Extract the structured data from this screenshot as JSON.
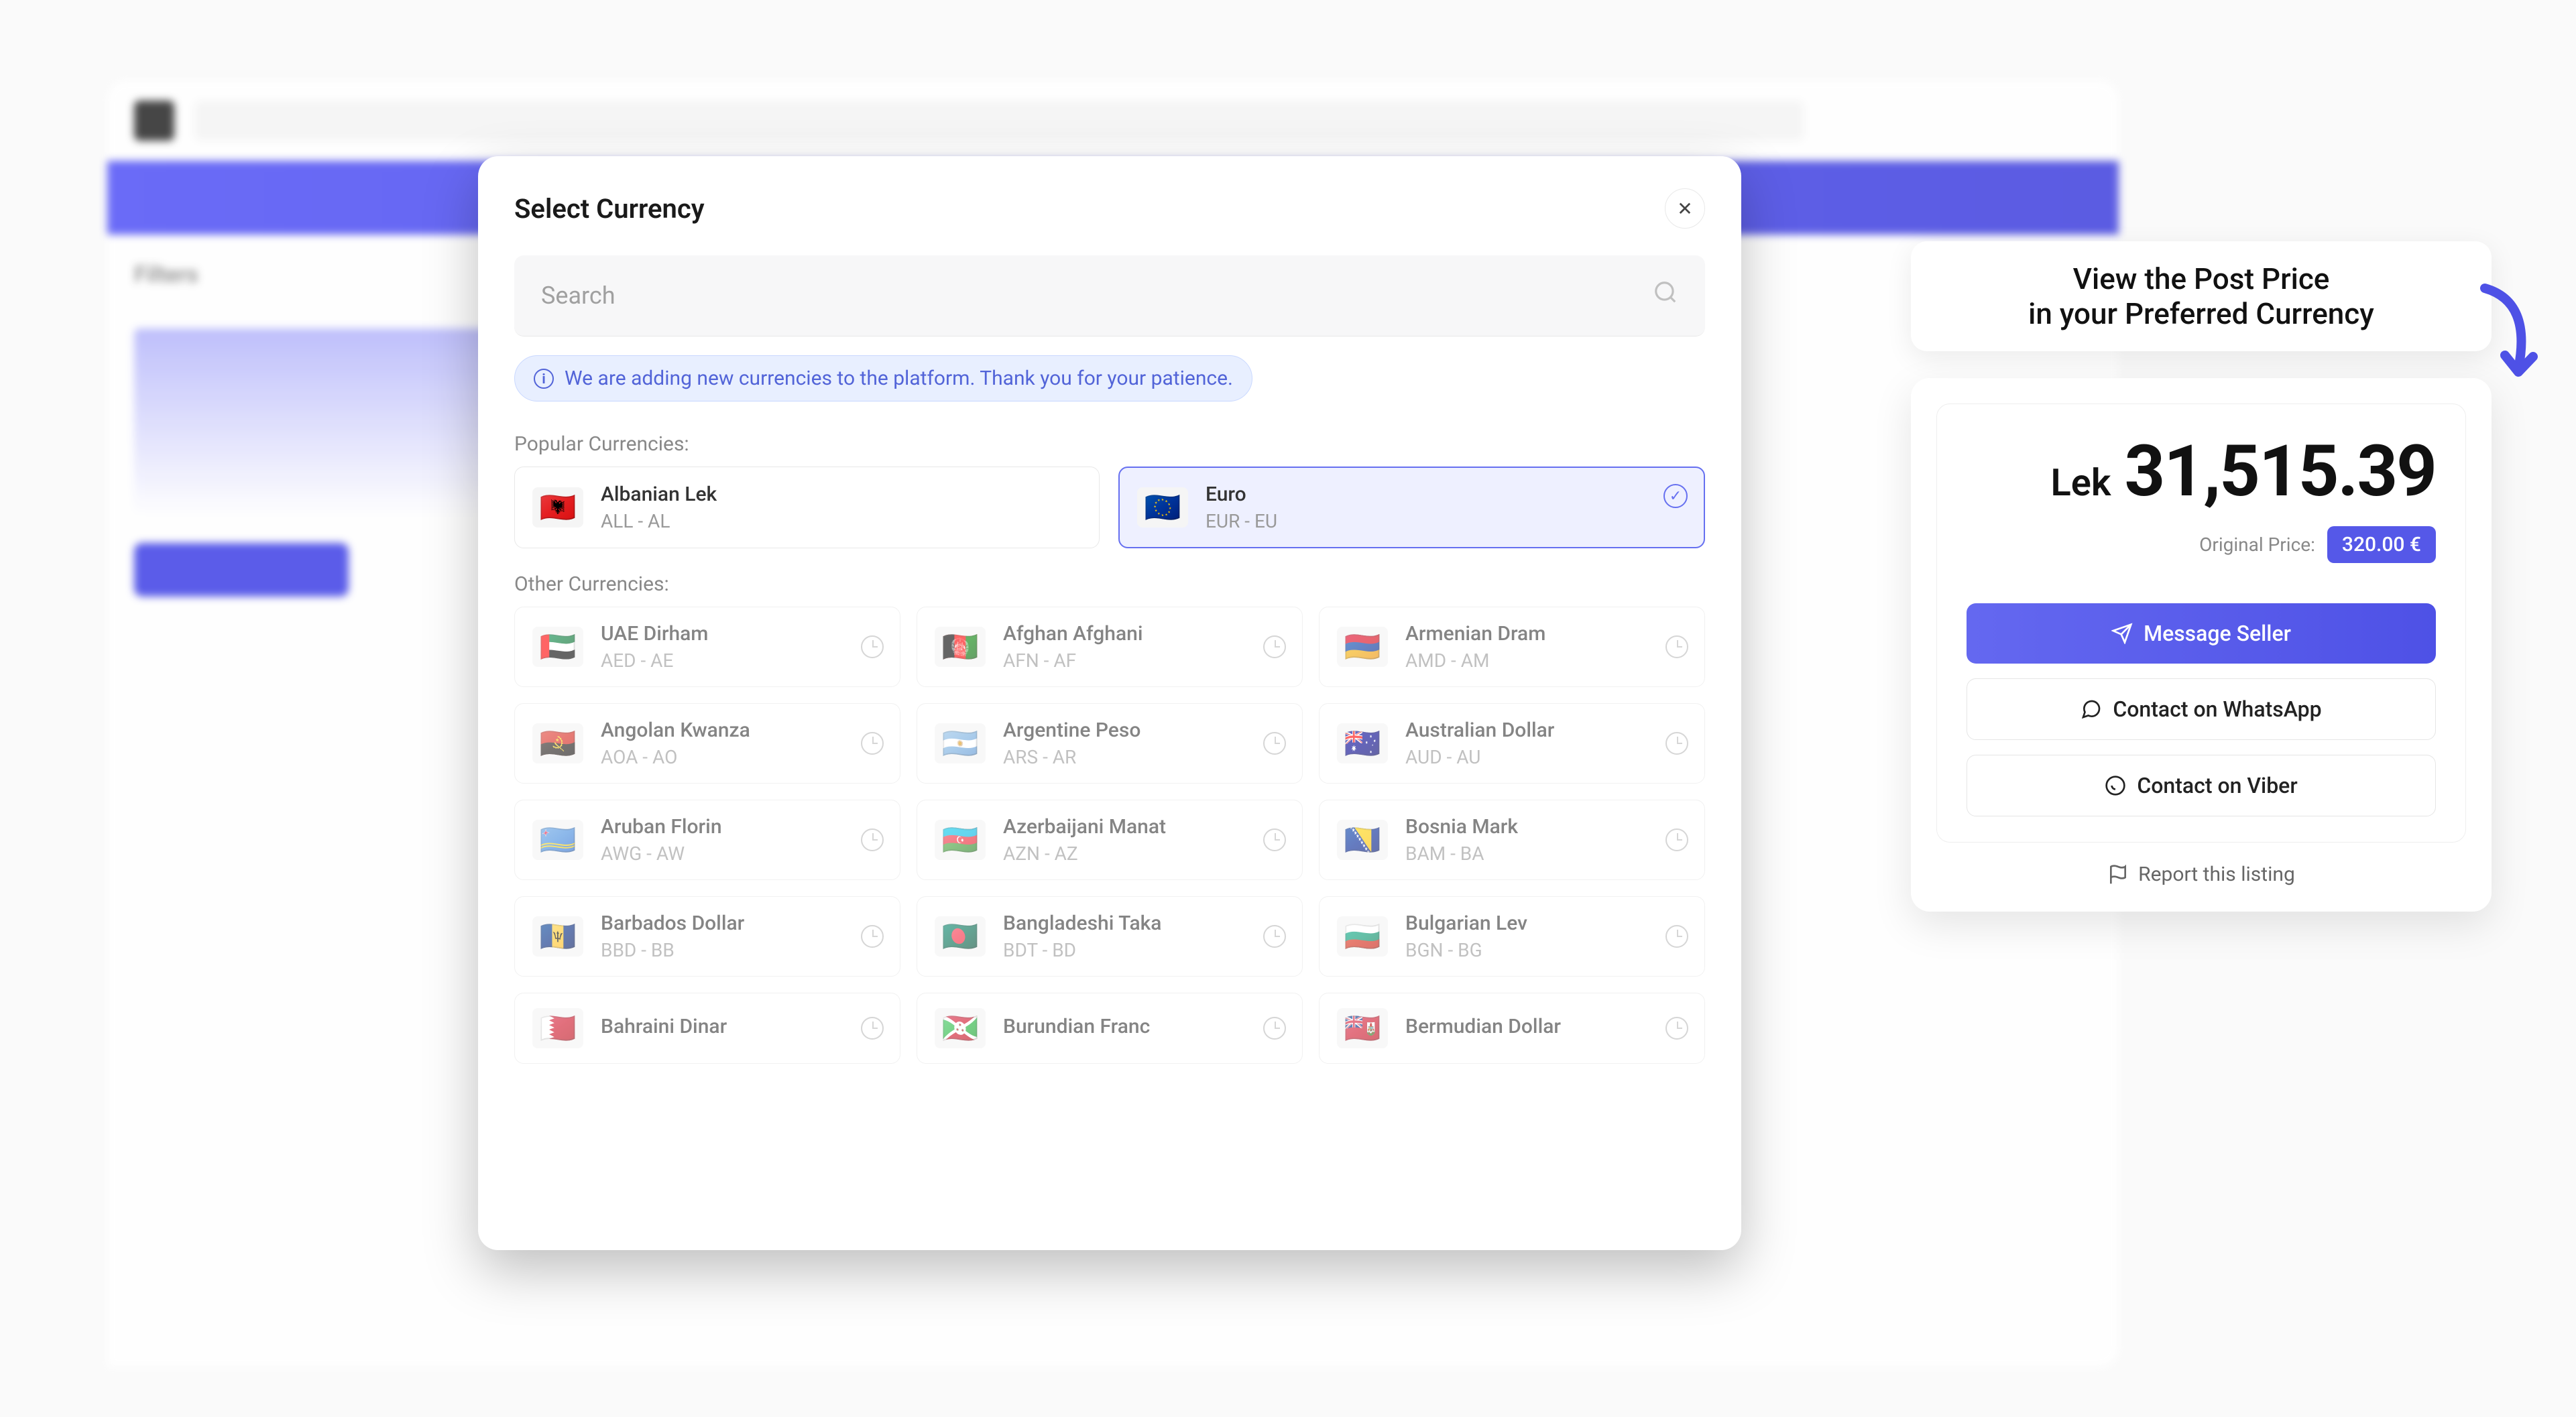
{
  "modal": {
    "title": "Select Currency",
    "searchPlaceholder": "Search",
    "infoBanner": "We are adding new currencies to the platform. Thank you for your patience.",
    "popularLabel": "Popular Currencies:",
    "otherLabel": "Other Currencies:",
    "popular": [
      {
        "flag": "🇦🇱",
        "name": "Albanian Lek",
        "code": "ALL - AL",
        "selected": false
      },
      {
        "flag": "🇪🇺",
        "name": "Euro",
        "code": "EUR - EU",
        "selected": true
      }
    ],
    "other": [
      {
        "flag": "🇦🇪",
        "name": "UAE Dirham",
        "code": "AED - AE"
      },
      {
        "flag": "🇦🇫",
        "name": "Afghan Afghani",
        "code": "AFN - AF"
      },
      {
        "flag": "🇦🇲",
        "name": "Armenian Dram",
        "code": "AMD - AM"
      },
      {
        "flag": "🇦🇴",
        "name": "Angolan Kwanza",
        "code": "AOA - AO"
      },
      {
        "flag": "🇦🇷",
        "name": "Argentine Peso",
        "code": "ARS - AR"
      },
      {
        "flag": "🇦🇺",
        "name": "Australian Dollar",
        "code": "AUD - AU"
      },
      {
        "flag": "🇦🇼",
        "name": "Aruban Florin",
        "code": "AWG - AW"
      },
      {
        "flag": "🇦🇿",
        "name": "Azerbaijani Manat",
        "code": "AZN - AZ"
      },
      {
        "flag": "🇧🇦",
        "name": "Bosnia Mark",
        "code": "BAM - BA"
      },
      {
        "flag": "🇧🇧",
        "name": "Barbados Dollar",
        "code": "BBD - BB"
      },
      {
        "flag": "🇧🇩",
        "name": "Bangladeshi Taka",
        "code": "BDT - BD"
      },
      {
        "flag": "🇧🇬",
        "name": "Bulgarian Lev",
        "code": "BGN - BG"
      },
      {
        "flag": "🇧🇭",
        "name": "Bahraini Dinar",
        "code": ""
      },
      {
        "flag": "🇧🇮",
        "name": "Burundian Franc",
        "code": ""
      },
      {
        "flag": "🇧🇲",
        "name": "Bermudian Dollar",
        "code": ""
      }
    ]
  },
  "promo": {
    "line1": "View the Post Price",
    "line2": "in your Preferred Currency"
  },
  "priceCard": {
    "symbol": "Lek",
    "value": "31,515.39",
    "origLabel": "Original Price:",
    "origValue": "320.00 €",
    "messageSeller": "Message Seller",
    "whatsapp": "Contact on WhatsApp",
    "viber": "Contact on Viber",
    "report": "Report this listing"
  }
}
